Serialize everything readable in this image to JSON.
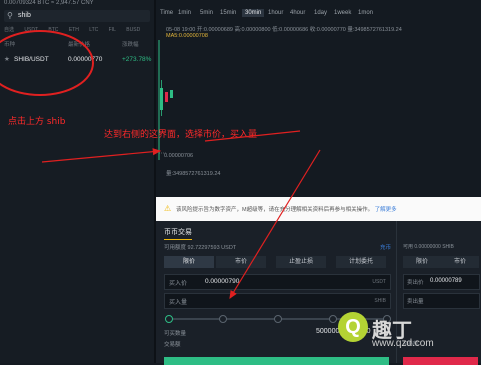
{
  "left_panel": {
    "top_info": "0.00709324 BTC ≈ 2,947.57 CNY",
    "search_value": "shib",
    "tabs": [
      "自选",
      "USDT",
      "BTC",
      "ETH",
      "LTC",
      "FIL",
      "BUSD"
    ],
    "headers": {
      "pair": "币种",
      "price": "最新价格",
      "change": "涨跌幅"
    },
    "rows": [
      {
        "pair": "SHIB/USDT",
        "price": "0.00000770",
        "change": "+273.78%"
      }
    ]
  },
  "annotations": {
    "note_left": "点击上方 shib",
    "note_right": "达到右侧的这界面，选择市价，买入量"
  },
  "chart_panel": {
    "timeframes": [
      "Time",
      "1min",
      "5min",
      "15min",
      "30min",
      "1hour",
      "4hour",
      "1day",
      "1week",
      "1mon"
    ],
    "active_timeframe": "30min",
    "ohlc": "05-08 19:00  开:0.00000689  高:0.00000800  低:0.00000686  收:0.00000770  量:3498572761319.24",
    "ma": "MA5:0.00000708",
    "low_label": "0.00000706",
    "volume": "量:3498572761319.24",
    "colors": {
      "up": "#2ebd85",
      "down": "#e0294a",
      "ma": "#e5b73b"
    }
  },
  "notice": {
    "text": "该风险提示旨为数字资产，M超级等，请在充分理解相关资料后再参与相关操作。",
    "link": "了解更多"
  },
  "trade_panel": {
    "title": "币币交易",
    "available": "可用额度 92.72297593 USDT",
    "deposit": "充币",
    "order_tabs": [
      "限价",
      "市价",
      "止盈止损",
      "计划委托"
    ],
    "price_label": "买入价",
    "price_value": "0.00000790",
    "price_unit": "USDT",
    "amount_label": "买入量",
    "amount_unit": "SHIB",
    "slider_label": "可买数量",
    "amount_value": "50000000000000",
    "total_label": "交易额",
    "sell_available": "可用 0.00000000 SHIB",
    "sell_tabs": [
      "限价",
      "市价"
    ],
    "sell_price_label": "卖出价",
    "sell_price_value": "0.00000789",
    "sell_amount_label": "卖出量",
    "sell_fee_label": "交易额"
  },
  "watermark": {
    "logo_char": "Q",
    "brand": "趣丁",
    "url": "www.qzd.com"
  }
}
